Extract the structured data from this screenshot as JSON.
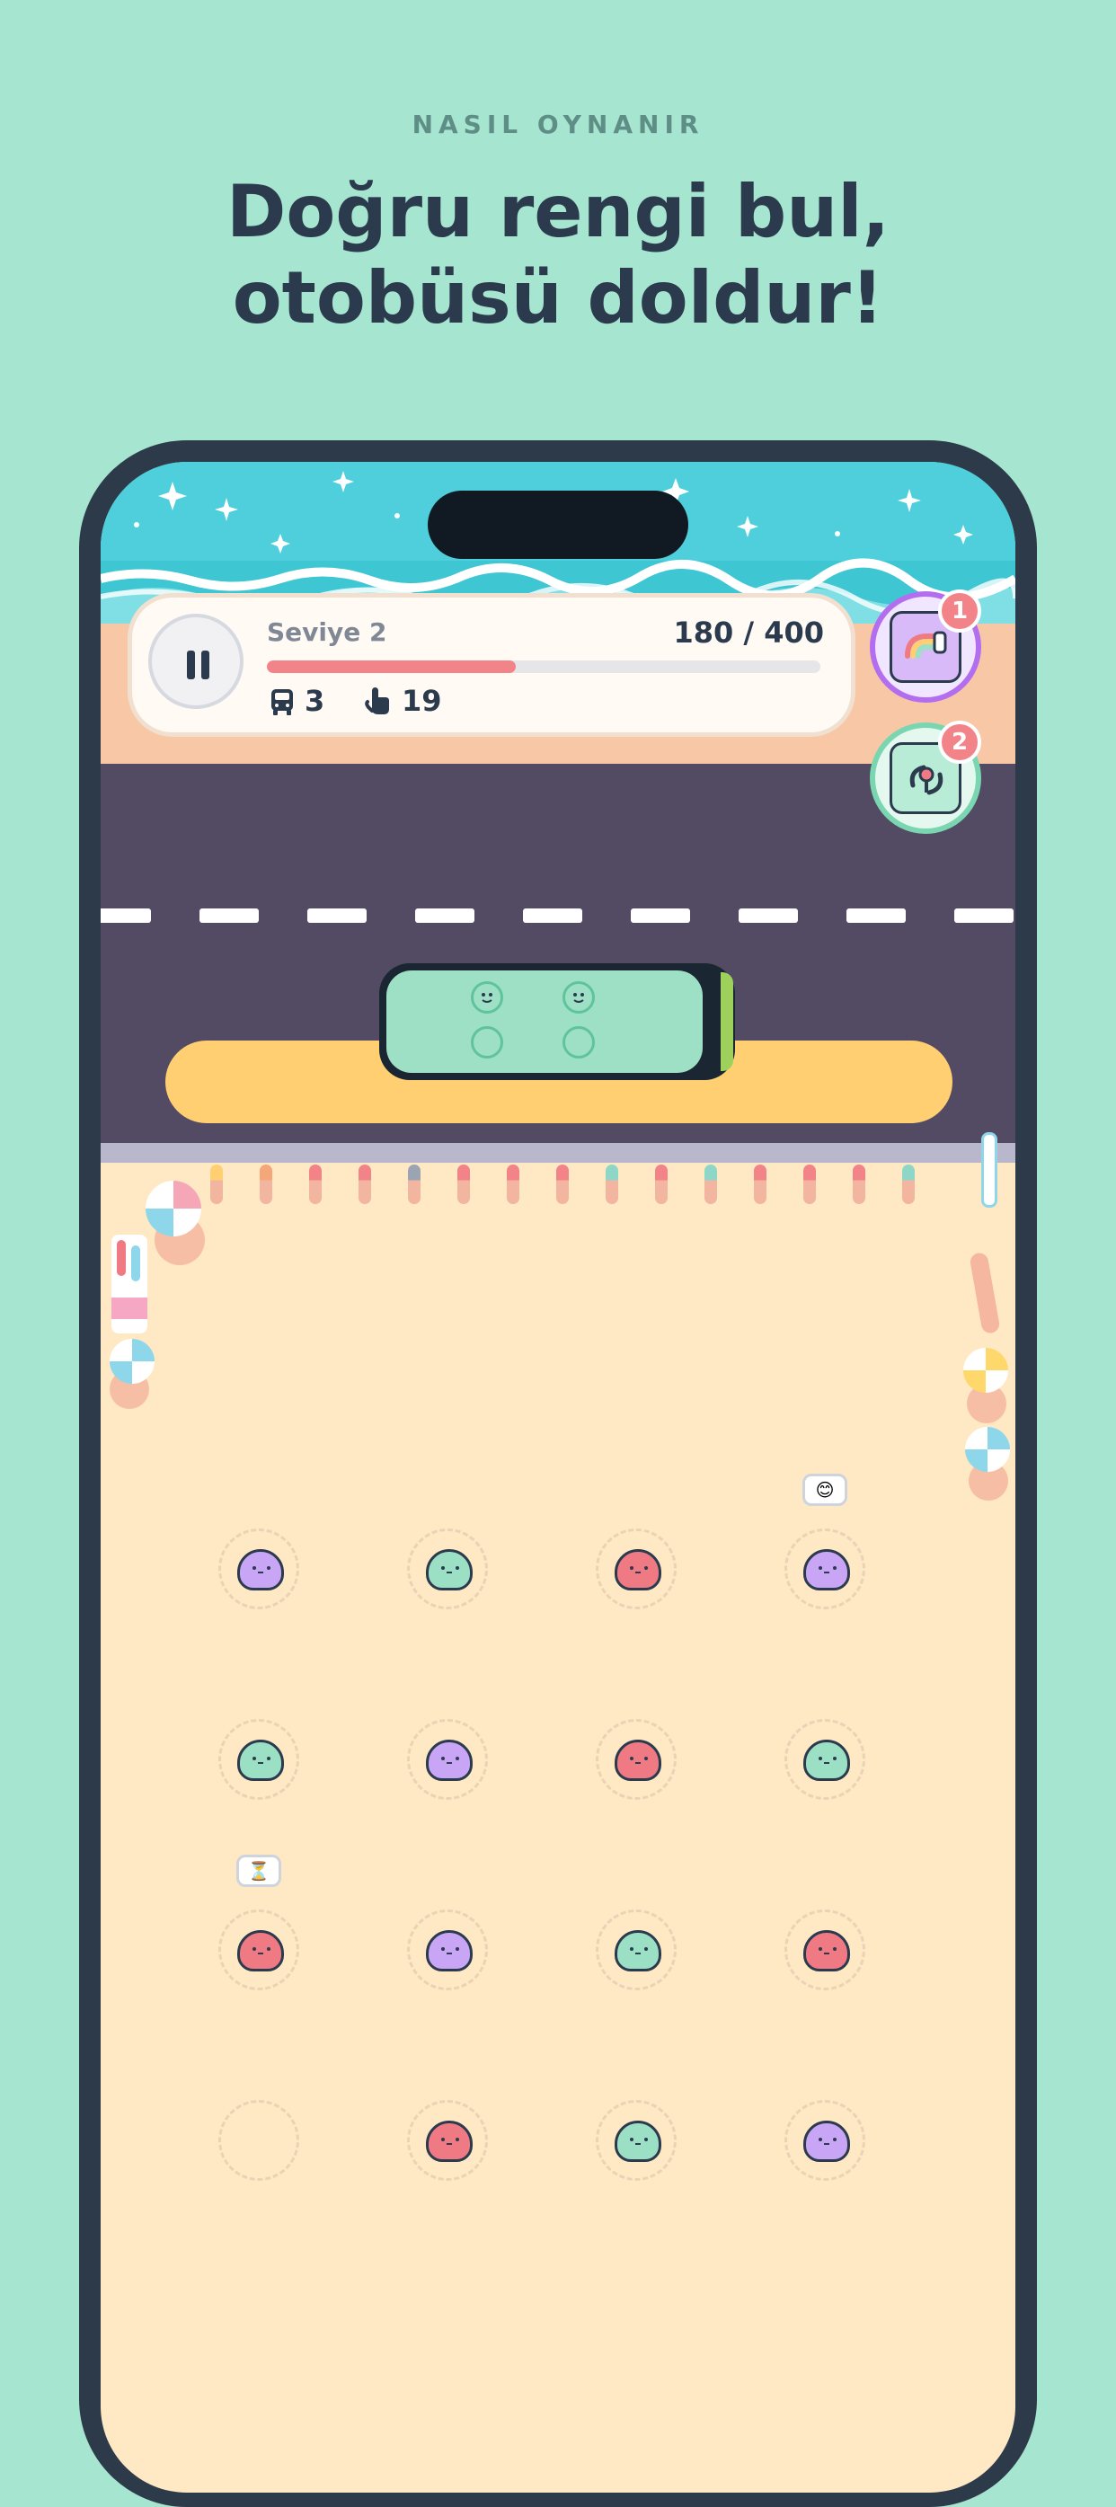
{
  "header": {
    "eyebrow": "NASIL OYNANIR",
    "title_line1": "Doğru rengi bul,",
    "title_line2": "otobüsü doldur!"
  },
  "hud": {
    "level_label": "Seviye 2",
    "score_text": "180 / 400",
    "progress_fraction": 0.45,
    "buses_count": "3",
    "taps_count": "19"
  },
  "powerups": [
    {
      "name": "rainbow-swap",
      "badge": "1",
      "color": "#b36ef0"
    },
    {
      "name": "shuffle",
      "badge": "2",
      "color": "#7ad6b0"
    }
  ],
  "bus": {
    "color": "#9ee0c5",
    "seats": [
      "filled",
      "filled",
      "empty",
      "empty"
    ]
  },
  "palette": {
    "purple": "#c9a6f5",
    "green": "#9be0c4",
    "red": "#f07a84",
    "background": "#a6e5cf",
    "text": "#2b3a4d"
  },
  "grid": [
    [
      "purple",
      "green",
      "red",
      "purple"
    ],
    [
      "green",
      "purple",
      "red",
      "green"
    ],
    [
      "red",
      "purple",
      "green",
      "red"
    ],
    [
      "empty",
      "red",
      "green",
      "purple"
    ]
  ],
  "bubbles": [
    {
      "row": 0,
      "col": 3,
      "icon": "😊"
    },
    {
      "row": 2,
      "col": 0,
      "icon": "⏳"
    }
  ]
}
